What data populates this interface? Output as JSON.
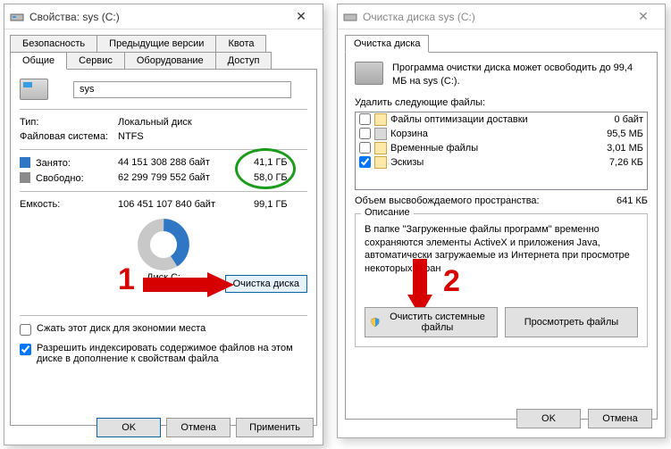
{
  "left_dialog": {
    "title": "Свойства: sys (C:)",
    "tabs_row1": [
      "Безопасность",
      "Предыдущие версии",
      "Квота"
    ],
    "tabs_row2": [
      "Общие",
      "Сервис",
      "Оборудование",
      "Доступ"
    ],
    "drive_name": "sys",
    "type_label": "Тип:",
    "type_value": "Локальный диск",
    "fs_label": "Файловая система:",
    "fs_value": "NTFS",
    "used_label": "Занято:",
    "used_bytes": "44 151 308 288 байт",
    "used_human": "41,1 ГБ",
    "free_label": "Свободно:",
    "free_bytes": "62 299 799 552 байт",
    "free_human": "58,0 ГБ",
    "cap_label": "Емкость:",
    "cap_bytes": "106 451 107 840 байт",
    "cap_human": "99,1 ГБ",
    "drive_letter": "Диск C:",
    "cleanup_btn": "Очистка диска",
    "compress_label": "Сжать этот диск для экономии места",
    "index_label": "Разрешить индексировать содержимое файлов на этом диске в дополнение к свойствам файла",
    "ok": "OK",
    "cancel": "Отмена",
    "apply": "Применить"
  },
  "right_dialog": {
    "title": "Очистка диска sys (C:)",
    "tab": "Очистка диска",
    "summary": "Программа очистки диска может освободить до 99,4 МБ на sys (C:).",
    "delete_label": "Удалить следующие файлы:",
    "files": [
      {
        "name": "Файлы оптимизации доставки",
        "size": "0 байт",
        "checked": false
      },
      {
        "name": "Корзина",
        "size": "95,5 МБ",
        "checked": false
      },
      {
        "name": "Временные файлы",
        "size": "3,01 МБ",
        "checked": false
      },
      {
        "name": "Эскизы",
        "size": "7,26 КБ",
        "checked": true
      }
    ],
    "total_label": "Объем высвобождаемого пространства:",
    "total_value": "641 КБ",
    "group_title": "Описание",
    "desc": "В папке \"Загруженные файлы программ\" временно сохраняются элементы ActiveX и приложения Java, автоматически загружаемые из Интернета при просмотре некоторых стран",
    "sys_btn": "Очистить системные файлы",
    "view_btn": "Просмотреть файлы",
    "ok": "OK",
    "cancel": "Отмена"
  },
  "annotations": {
    "num1": "1",
    "num2": "2"
  }
}
